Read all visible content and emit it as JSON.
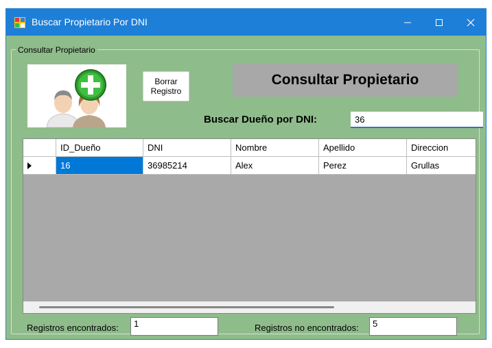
{
  "window": {
    "title": "Buscar Propietario Por DNI",
    "controls": {
      "minimize": "minimize-icon",
      "maximize": "maximize-icon",
      "close": "close-icon"
    }
  },
  "group": {
    "legend": "Consultar Propietario"
  },
  "picture": {
    "icon": "add-owner-icon",
    "description_icon": "two-people-with-plus"
  },
  "toolbar": {
    "clear_label_line1": "Borrar",
    "clear_label_line2": "Registro"
  },
  "banner": {
    "title": "Consultar Propietario"
  },
  "search": {
    "label": "Buscar Dueño por DNI:",
    "value": "36"
  },
  "table": {
    "columns": [
      "ID_Dueño",
      "DNI",
      "Nombre",
      "Apellido",
      "Direccion"
    ],
    "rows": [
      {
        "id": "16",
        "dni": "36985214",
        "nombre": "Alex",
        "apellido": "Perez",
        "direccion": "Grullas"
      }
    ]
  },
  "stats": {
    "found_label": "Registros encontrados:",
    "found_value": "1",
    "not_found_label": "Registros no encontrados:",
    "not_found_value": "5"
  },
  "colors": {
    "titlebar": "#1e7fd8",
    "form_bg": "#8fbc8b",
    "selection": "#0078d7",
    "banner_bg": "#a8a8a8"
  }
}
